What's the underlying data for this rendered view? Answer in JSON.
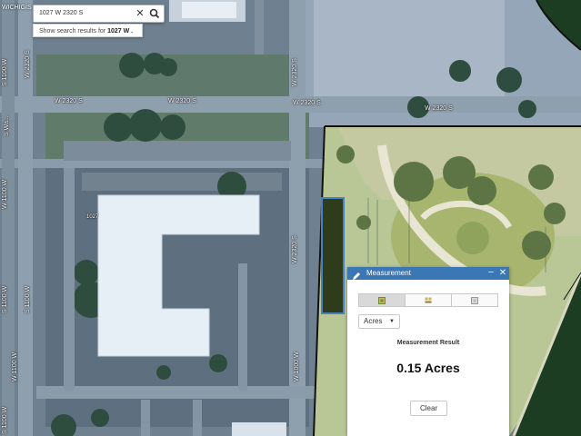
{
  "brand": {
    "text": "WICHIGIS"
  },
  "search": {
    "value": "1027 W 2320 S",
    "clear_icon": "close-icon",
    "search_icon": "magnifier-icon",
    "suggestion_prefix": "Show search results for ",
    "suggestion_term": "1027 W ."
  },
  "map": {
    "streets": {
      "w2320s_a": "W 2320 S",
      "w2320s_b": "W 2320 S",
      "w2320s_c": "W 2320 S",
      "v_left_1": "S 1100 W",
      "v_left_2": "S Wa...",
      "v_left_3": "W 2320 S",
      "v_left_4": "W 1100 W",
      "v_left_5": "S 1100 W",
      "v_mid_1": "W 2320 S",
      "v_mid_2": "W 2320 S",
      "v_mid_3": "W 1000 W",
      "building_no": "1027"
    }
  },
  "panel": {
    "title": "Measurement",
    "minimize": "–",
    "close": "✕",
    "tools": [
      {
        "name": "area-tool",
        "icon": "area-icon"
      },
      {
        "name": "distance-tool",
        "icon": "distance-icon"
      },
      {
        "name": "location-tool",
        "icon": "location-icon"
      }
    ],
    "unit": "Acres",
    "result_label": "Measurement Result",
    "result_value": "0.15 Acres",
    "clear_label": "Clear"
  },
  "colors": {
    "header": "#3b77b5",
    "measured_polygon": "#2e3c1c",
    "selection_outline": "#111111"
  }
}
